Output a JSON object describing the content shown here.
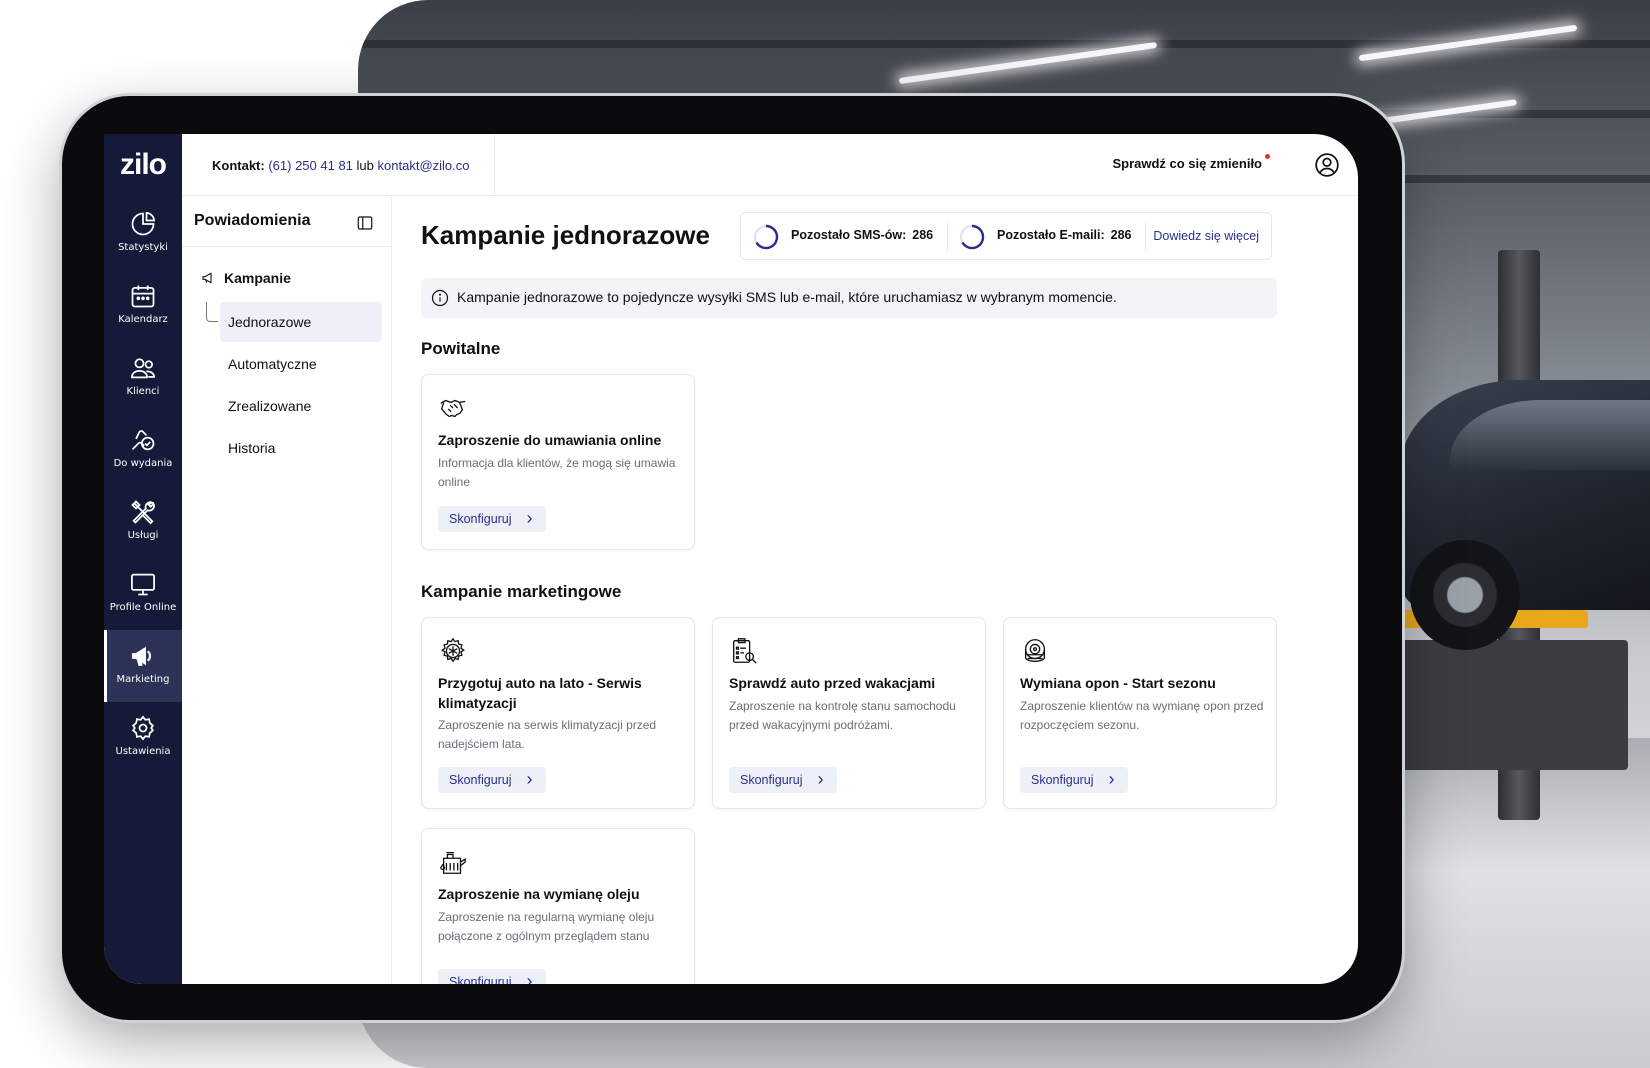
{
  "app": {
    "logo": "zilo"
  },
  "topbar": {
    "contact_label": "Kontakt:",
    "phone": "(61) 250 41 81",
    "or": "lub",
    "email": "kontakt@zilo.co",
    "whats_new": "Sprawdź co się zmieniło"
  },
  "sidebar": {
    "items": [
      {
        "label": "Statystyki",
        "icon": "pie-chart-icon"
      },
      {
        "label": "Kalendarz",
        "icon": "calendar-icon"
      },
      {
        "label": "Klienci",
        "icon": "users-icon"
      },
      {
        "label": "Do wydania",
        "icon": "hand-check-icon"
      },
      {
        "label": "Usługi",
        "icon": "tools-icon"
      },
      {
        "label": "Profile Online",
        "icon": "monitor-icon"
      },
      {
        "label": "Markieting",
        "icon": "megaphone-icon",
        "active": true
      },
      {
        "label": "Ustawienia",
        "icon": "gear-icon"
      }
    ]
  },
  "subnav": {
    "title": "Powiadomienia",
    "group": "Kampanie",
    "items": [
      "Jednorazowe",
      "Automatyczne",
      "Zrealizowane",
      "Historia"
    ],
    "active": "Jednorazowe"
  },
  "main": {
    "title": "Kampanie jednorazowe",
    "quota": {
      "sms_label": "Pozostało SMS-ów:",
      "sms_value": "286",
      "email_label": "Pozostało E-maili:",
      "email_value": "286",
      "more_link": "Dowiedz się więcej"
    },
    "info": "Kampanie jednorazowe to pojedyncze wysyłki SMS lub e-mail, które uruchamiasz w wybranym momencie.",
    "sections": [
      {
        "title": "Powitalne",
        "cards": [
          {
            "icon": "handshake-icon",
            "title": "Zaproszenie do umawiania online",
            "desc": "Informacja dla klientów, że mogą się umawia online",
            "button": "Skonfiguruj"
          }
        ]
      },
      {
        "title": "Kampanie marketingowe",
        "cards": [
          {
            "icon": "ac-gear-icon",
            "title": "Przygotuj auto na lato - Serwis klimatyzacji",
            "desc": "Zaproszenie na serwis klimatyzacji przed nadejściem lata.",
            "button": "Skonfiguruj"
          },
          {
            "icon": "checklist-icon",
            "title": "Sprawdź auto przed wakacjami",
            "desc": "Zaproszenie na kontrolę stanu samochodu przed wakacyjnymi podróżami.",
            "button": "Skonfiguruj"
          },
          {
            "icon": "tire-icon",
            "title": "Wymiana opon - Start sezonu",
            "desc": "Zaproszenie klientów na wymianę opon przed rozpoczęciem sezonu.",
            "button": "Skonfiguruj"
          },
          {
            "icon": "oil-can-icon",
            "title": "Zaproszenie na wymianę oleju",
            "desc": "Zaproszenie na regularną wymianę oleju połączone z ogólnym przeglądem stanu",
            "button": "Skonfiguruj"
          }
        ]
      }
    ]
  },
  "colors": {
    "sidebar": "#141a38",
    "accent": "#2b2f8a",
    "notification_dot": "#e0312d"
  }
}
